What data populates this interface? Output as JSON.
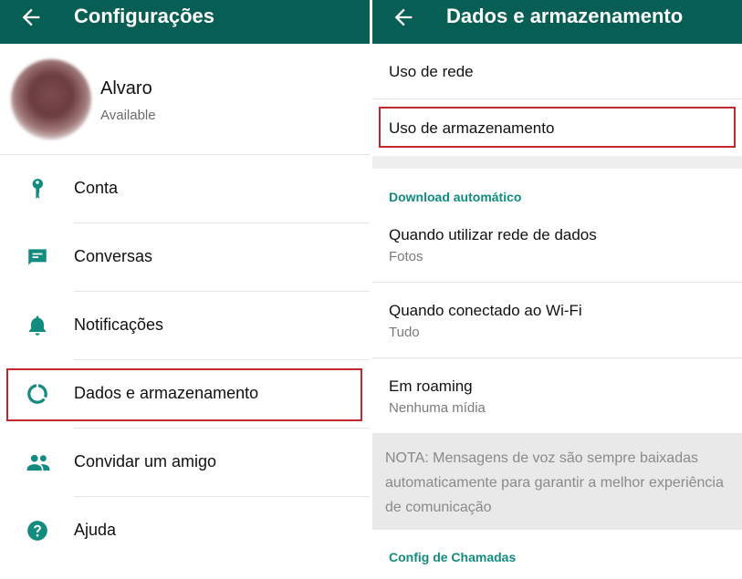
{
  "left": {
    "header": {
      "title": "Configurações",
      "back_icon": "arrow-left-icon"
    },
    "profile": {
      "name": "Alvaro",
      "status": "Available"
    },
    "menu": [
      {
        "label": "Conta",
        "icon": "key-icon"
      },
      {
        "label": "Conversas",
        "icon": "chat-icon"
      },
      {
        "label": "Notificações",
        "icon": "bell-icon"
      },
      {
        "label": "Dados e armazenamento",
        "icon": "data-usage-icon"
      },
      {
        "label": "Convidar um amigo",
        "icon": "people-icon"
      },
      {
        "label": "Ajuda",
        "icon": "help-icon"
      }
    ]
  },
  "right": {
    "header": {
      "title": "Dados e armazenamento",
      "back_icon": "arrow-left-icon"
    },
    "items": {
      "network_usage": "Uso de rede",
      "storage_usage": "Uso de armazenamento"
    },
    "auto_download": {
      "header": "Download automático",
      "mobile": {
        "title": "Quando utilizar rede de dados",
        "value": "Fotos"
      },
      "wifi": {
        "title": "Quando conectado ao Wi-Fi",
        "value": "Tudo"
      },
      "roaming": {
        "title": "Em roaming",
        "value": "Nenhuma mídia"
      }
    },
    "note": "NOTA: Mensagens de voz são sempre baixadas automaticamente para garantir a melhor experiência de comunicação",
    "calls_header": "Config de Chamadas"
  },
  "colors": {
    "appbar": "#075e54",
    "accent": "#128c7e",
    "highlight": "#c0282e"
  }
}
